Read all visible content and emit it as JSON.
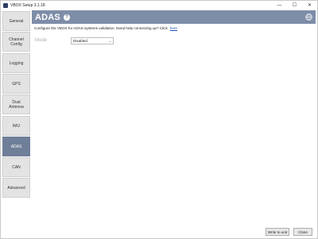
{
  "window": {
    "title": "VBOX Setup 3.1.18",
    "controls": [
      "—",
      "☐",
      "✕"
    ]
  },
  "sidebar": {
    "items": [
      {
        "label": "General",
        "active": false
      },
      {
        "label": "Channel Config",
        "active": false
      },
      {
        "label": "Logging",
        "active": false
      },
      {
        "label": "GPS",
        "active": false
      },
      {
        "label": "Dual Antenna",
        "active": false
      },
      {
        "label": "IMU",
        "active": false
      },
      {
        "label": "ADAS",
        "active": true
      },
      {
        "label": "CAN",
        "active": false
      },
      {
        "label": "Advanced",
        "active": false
      }
    ]
  },
  "header": {
    "title": "ADAS",
    "help_icon": "help-icon",
    "globe_icon": "globe-icon"
  },
  "main": {
    "description": "Configure the VBOX for ADAS systems validation.  Need help connecting up?  Click",
    "link_text": "here",
    "mode_label": "Mode",
    "mode_value": "Disabled"
  },
  "footer": {
    "write_label": "Write to unit",
    "close_label": "Close"
  },
  "colors": {
    "accent": "#7e8da8",
    "active_tab": "#6f7f99"
  }
}
